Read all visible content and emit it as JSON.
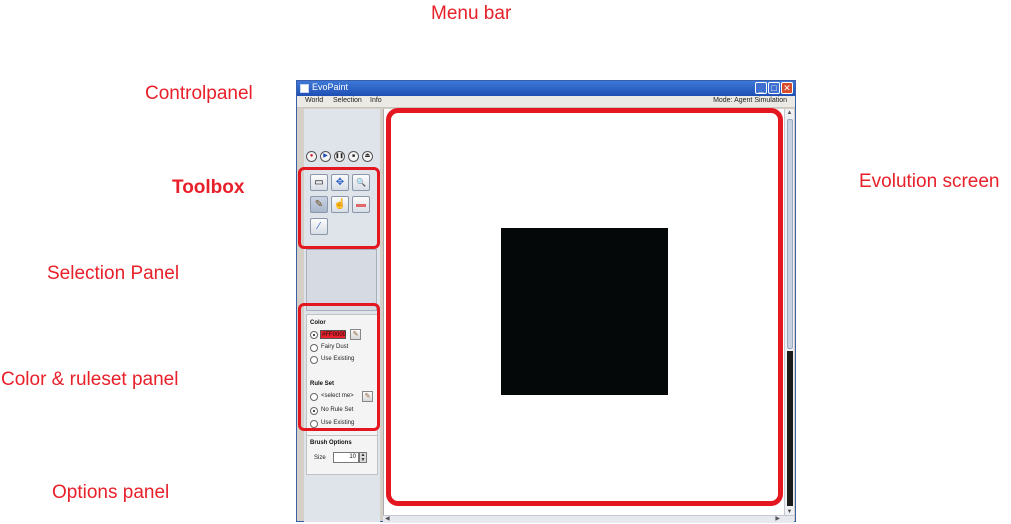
{
  "annotations": {
    "menu_bar": "Menu bar",
    "controlpanel": "Controlpanel",
    "toolbox": "Toolbox",
    "selection_panel": "Selection Panel",
    "color_ruleset_panel": "Color & ruleset panel",
    "options_panel": "Options panel",
    "evolution_screen": "Evolution screen"
  },
  "window": {
    "title": "EvoPaint",
    "minimize": "_",
    "maximize": "□",
    "close": "✕"
  },
  "menu": {
    "items": [
      "World",
      "Selection",
      "Info"
    ],
    "mode": "Mode: Agent Simulation"
  },
  "controls": {
    "record": "●",
    "play": "▶",
    "pause": "❚❚",
    "stop": "■",
    "eject": "⏏"
  },
  "tools": {
    "select": "▭",
    "move": "✥",
    "zoom": "🔍",
    "brush": "✎",
    "fill": "☝",
    "eraser": "▬",
    "picker": "⁄"
  },
  "color_panel": {
    "title": "Color",
    "hex_value": "#FF0000",
    "options": [
      "Fairy Dust",
      "Use Existing"
    ],
    "selected_option": "hex"
  },
  "ruleset_panel": {
    "title": "Rule Set",
    "options": [
      "<select me>",
      "No Rule Set",
      "Use Existing"
    ],
    "selected_option": "No Rule Set"
  },
  "brush_options": {
    "title": "Brush Options",
    "size_label": "Size",
    "size_value": "10"
  },
  "colors": {
    "annotation_red": "#e8202a",
    "canvas_square": "#050808",
    "titlebar_blue": "#2a5fc4"
  }
}
